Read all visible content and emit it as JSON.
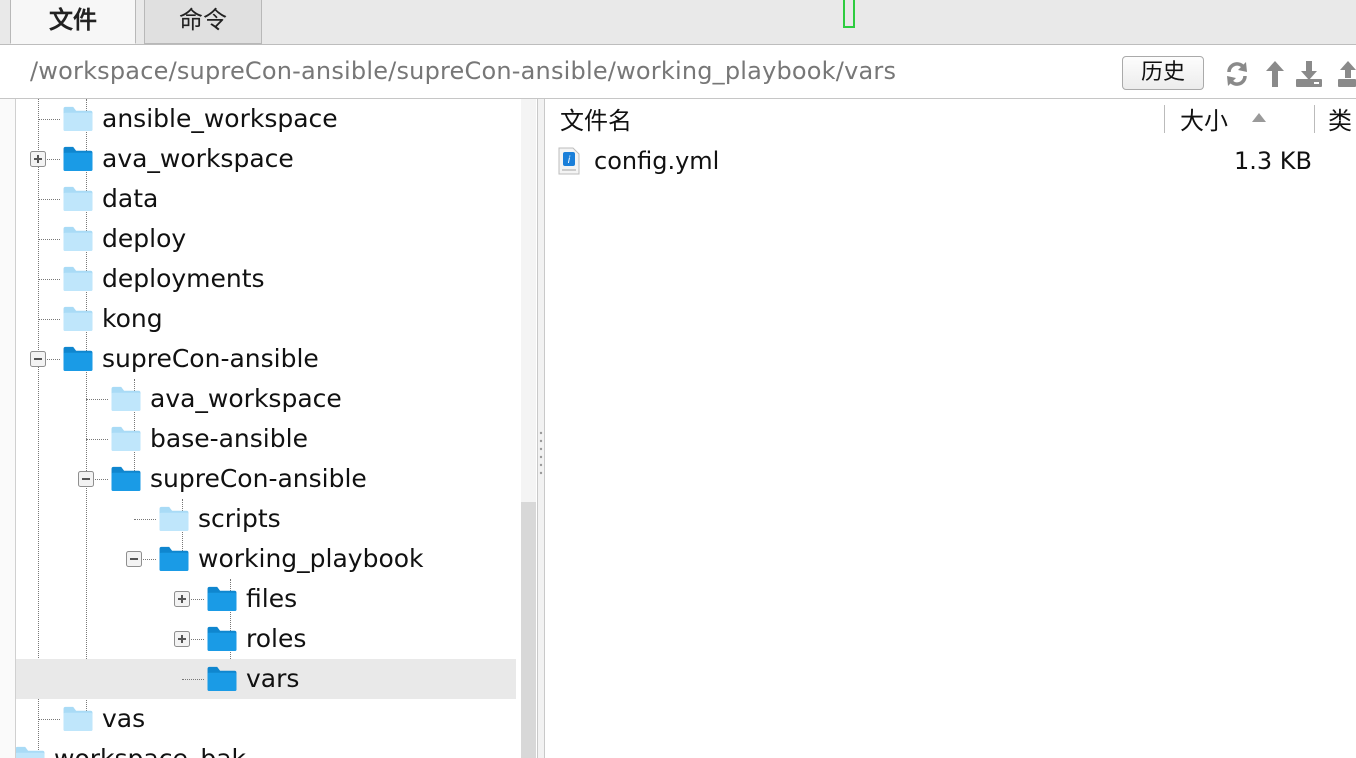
{
  "tabs": [
    {
      "label": "文件",
      "active": true
    },
    {
      "label": "命令",
      "active": false
    }
  ],
  "pathbar": {
    "path": "/workspace/supreCon-ansible/supreCon-ansible/working_playbook/vars",
    "history_label": "历史",
    "icons": [
      "refresh-icon",
      "upload-icon",
      "download-icon",
      "upload-alt-icon"
    ]
  },
  "tree": {
    "items": [
      {
        "label": "ansible_workspace",
        "level": 1,
        "expander": "none",
        "folder": "light"
      },
      {
        "label": "ava_workspace",
        "level": 1,
        "expander": "plus",
        "folder": "blue"
      },
      {
        "label": "data",
        "level": 1,
        "expander": "none",
        "folder": "light"
      },
      {
        "label": "deploy",
        "level": 1,
        "expander": "none",
        "folder": "light"
      },
      {
        "label": "deployments",
        "level": 1,
        "expander": "none",
        "folder": "light"
      },
      {
        "label": "kong",
        "level": 1,
        "expander": "none",
        "folder": "light"
      },
      {
        "label": "supreCon-ansible",
        "level": 1,
        "expander": "minus",
        "folder": "blue"
      },
      {
        "label": "ava_workspace",
        "level": 2,
        "expander": "none",
        "folder": "light"
      },
      {
        "label": "base-ansible",
        "level": 2,
        "expander": "none",
        "folder": "light"
      },
      {
        "label": "supreCon-ansible",
        "level": 2,
        "expander": "minus",
        "folder": "blue"
      },
      {
        "label": "scripts",
        "level": 3,
        "expander": "none",
        "folder": "light"
      },
      {
        "label": "working_playbook",
        "level": 3,
        "expander": "minus",
        "folder": "blue"
      },
      {
        "label": "files",
        "level": 4,
        "expander": "plus",
        "folder": "blue"
      },
      {
        "label": "roles",
        "level": 4,
        "expander": "plus",
        "folder": "blue"
      },
      {
        "label": "vars",
        "level": 4,
        "expander": "none",
        "folder": "blue",
        "selected": true
      },
      {
        "label": "vas",
        "level": 1,
        "expander": "none",
        "folder": "light"
      },
      {
        "label": "workspace_bak",
        "level": 0,
        "expander": "none",
        "folder": "light"
      }
    ]
  },
  "filelist": {
    "columns": [
      {
        "label": "文件名"
      },
      {
        "label": "大小",
        "sorted": "ascending"
      },
      {
        "label": "类"
      }
    ],
    "files": [
      {
        "name": "config.yml",
        "size": "1.3 KB",
        "icon": "yaml-file-icon"
      }
    ]
  },
  "colors": {
    "folder_blue": "#1a9be6",
    "folder_light": "#bfe6fb",
    "selection": "#e9e9e9",
    "tab_bar": "#e9e9e9"
  }
}
